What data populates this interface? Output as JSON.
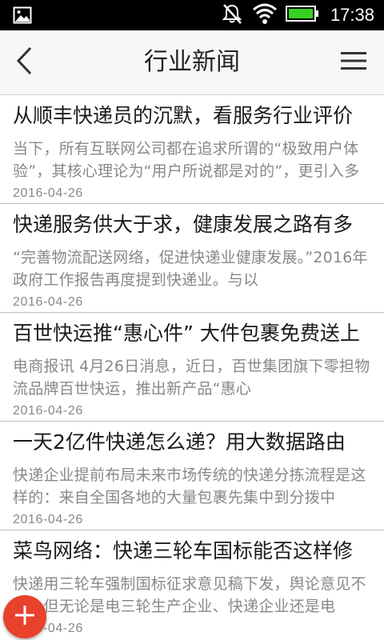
{
  "status_bar": {
    "time": "17:38",
    "icons": [
      "gallery-icon",
      "notifications-muted-icon",
      "wifi-icon",
      "battery-icon"
    ]
  },
  "header": {
    "title": "行业新闻",
    "back_icon": "back-arrow-icon",
    "menu_icon": "menu-icon"
  },
  "news": [
    {
      "title": "从顺丰快递员的沉默，看服务行业评价",
      "summary": "当下，所有互联网公司都在追求所谓的“极致用户体验”，其核心理论为“用户所说都是对的”，更引入多",
      "date": "2016-04-26"
    },
    {
      "title": "快递服务供大于求，健康发展之路有多",
      "summary": "“完善物流配送网络，促进快递业健康发展。”2016年政府工作报告再度提到快递业。与以",
      "date": "2016-04-26"
    },
    {
      "title": "百世快运推“惠心件” 大件包裹免费送上",
      "summary": "电商报讯 4月26日消息，近日，百世集团旗下零担物流品牌百世快运，推出新产品“惠心",
      "date": "2016-04-26"
    },
    {
      "title": "一天2亿件快递怎么递？用大数据路由",
      "summary": "快递企业提前布局未来市场传统的快递分拣流程是这样的：来自全国各地的大量包裹先集中到分拨中",
      "date": "2016-04-26"
    },
    {
      "title": "菜鸟网络：快递三轮车国标能否这样修",
      "summary": "快递用三轮车强制国标征求意见稿下发，舆论意见不一。但无论是电三轮生产企业、快递企业还是电",
      "date": "2016-04-26"
    }
  ],
  "fab": {
    "icon": "plus-icon",
    "color": "#e8412c"
  },
  "colors": {
    "status_bar": "#000000",
    "header_bg": "#f7f7f7",
    "summary_text": "#888888"
  }
}
